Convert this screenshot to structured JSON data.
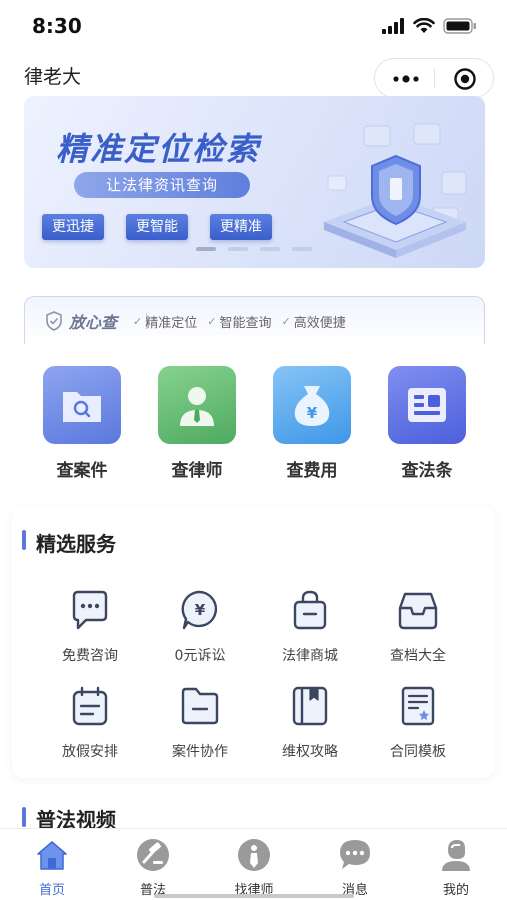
{
  "status": {
    "time": "8:30"
  },
  "navbar": {
    "title": "律老大"
  },
  "banner": {
    "headline": "精准定位检索",
    "subtitle": "让法律资讯查询",
    "tags": [
      "更迅捷",
      "更智能",
      "更精准"
    ],
    "colors": {
      "accent": "#3b5fc9"
    }
  },
  "trust": {
    "main_label": "放心查",
    "items": [
      "精准定位",
      "智能查询",
      "高效便捷"
    ]
  },
  "quick_actions": [
    {
      "label": "查案件",
      "icon": "folder-search-icon",
      "color": "#6a86e0"
    },
    {
      "label": "查律师",
      "icon": "lawyer-icon",
      "color": "#5fba70"
    },
    {
      "label": "查费用",
      "icon": "money-bag-icon",
      "color": "#5aa8ef"
    },
    {
      "label": "查法条",
      "icon": "document-icon",
      "color": "#5b6fe0"
    }
  ],
  "services": {
    "title": "精选服务",
    "items": [
      {
        "label": "免费咨询",
        "icon": "chat-bubble-icon"
      },
      {
        "label": "0元诉讼",
        "icon": "yen-bubble-icon"
      },
      {
        "label": "法律商城",
        "icon": "shopping-bag-icon"
      },
      {
        "label": "查档大全",
        "icon": "archive-box-icon"
      },
      {
        "label": "放假安排",
        "icon": "calendar-icon"
      },
      {
        "label": "案件协作",
        "icon": "folder-icon"
      },
      {
        "label": "维权攻略",
        "icon": "book-icon"
      },
      {
        "label": "合同模板",
        "icon": "contract-icon"
      }
    ]
  },
  "videos": {
    "title": "普法视频"
  },
  "tabbar": {
    "items": [
      {
        "label": "首页",
        "icon": "home-icon",
        "active": true
      },
      {
        "label": "普法",
        "icon": "gavel-icon",
        "active": false
      },
      {
        "label": "找律师",
        "icon": "lawyer-tie-icon",
        "active": false
      },
      {
        "label": "消息",
        "icon": "message-icon",
        "active": false
      },
      {
        "label": "我的",
        "icon": "user-icon",
        "active": false
      }
    ],
    "active_color": "#3d6ad6"
  }
}
